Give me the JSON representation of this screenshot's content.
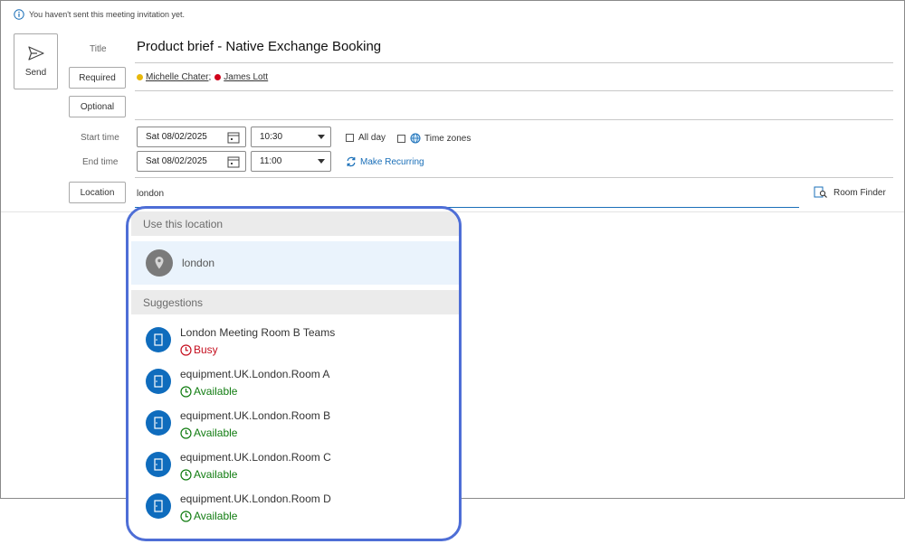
{
  "info_bar": {
    "text": "You haven't sent this meeting invitation yet."
  },
  "send": {
    "label": "Send"
  },
  "title": {
    "label": "Title",
    "value": "Product brief - Native Exchange Booking"
  },
  "required": {
    "button_label": "Required",
    "attendees": [
      {
        "name": "Michelle Chater",
        "separator": ";",
        "status_color": "#e8b80b"
      },
      {
        "name": "James Lott",
        "separator": "",
        "status_color": "#d0021b"
      }
    ]
  },
  "optional": {
    "button_label": "Optional"
  },
  "start": {
    "label": "Start time",
    "date": "Sat 08/02/2025",
    "time": "10:30"
  },
  "end": {
    "label": "End time",
    "date": "Sat 08/02/2025",
    "time": "11:00"
  },
  "all_day": {
    "label": "All day",
    "checked": false
  },
  "time_zones": {
    "label": "Time zones",
    "checked": false
  },
  "make_recurring": {
    "label": "Make Recurring"
  },
  "location": {
    "button_label": "Location",
    "value": "london"
  },
  "room_finder": {
    "label": "Room Finder"
  },
  "dropdown": {
    "use_header": "Use this location",
    "use_item": "london",
    "suggestions_header": "Suggestions",
    "suggestions": [
      {
        "name": "London Meeting Room B Teams",
        "status": "Busy",
        "status_color": "#c50f1f"
      },
      {
        "name": "equipment.UK.London.Room A",
        "status": "Available",
        "status_color": "#107c10"
      },
      {
        "name": "equipment.UK.London.Room B",
        "status": "Available",
        "status_color": "#107c10"
      },
      {
        "name": "equipment.UK.London.Room C",
        "status": "Available",
        "status_color": "#107c10"
      },
      {
        "name": "equipment.UK.London.Room D",
        "status": "Available",
        "status_color": "#107c10"
      }
    ]
  },
  "colors": {
    "accent": "#0f6cbd",
    "highlight_border": "#4e6ed6"
  }
}
